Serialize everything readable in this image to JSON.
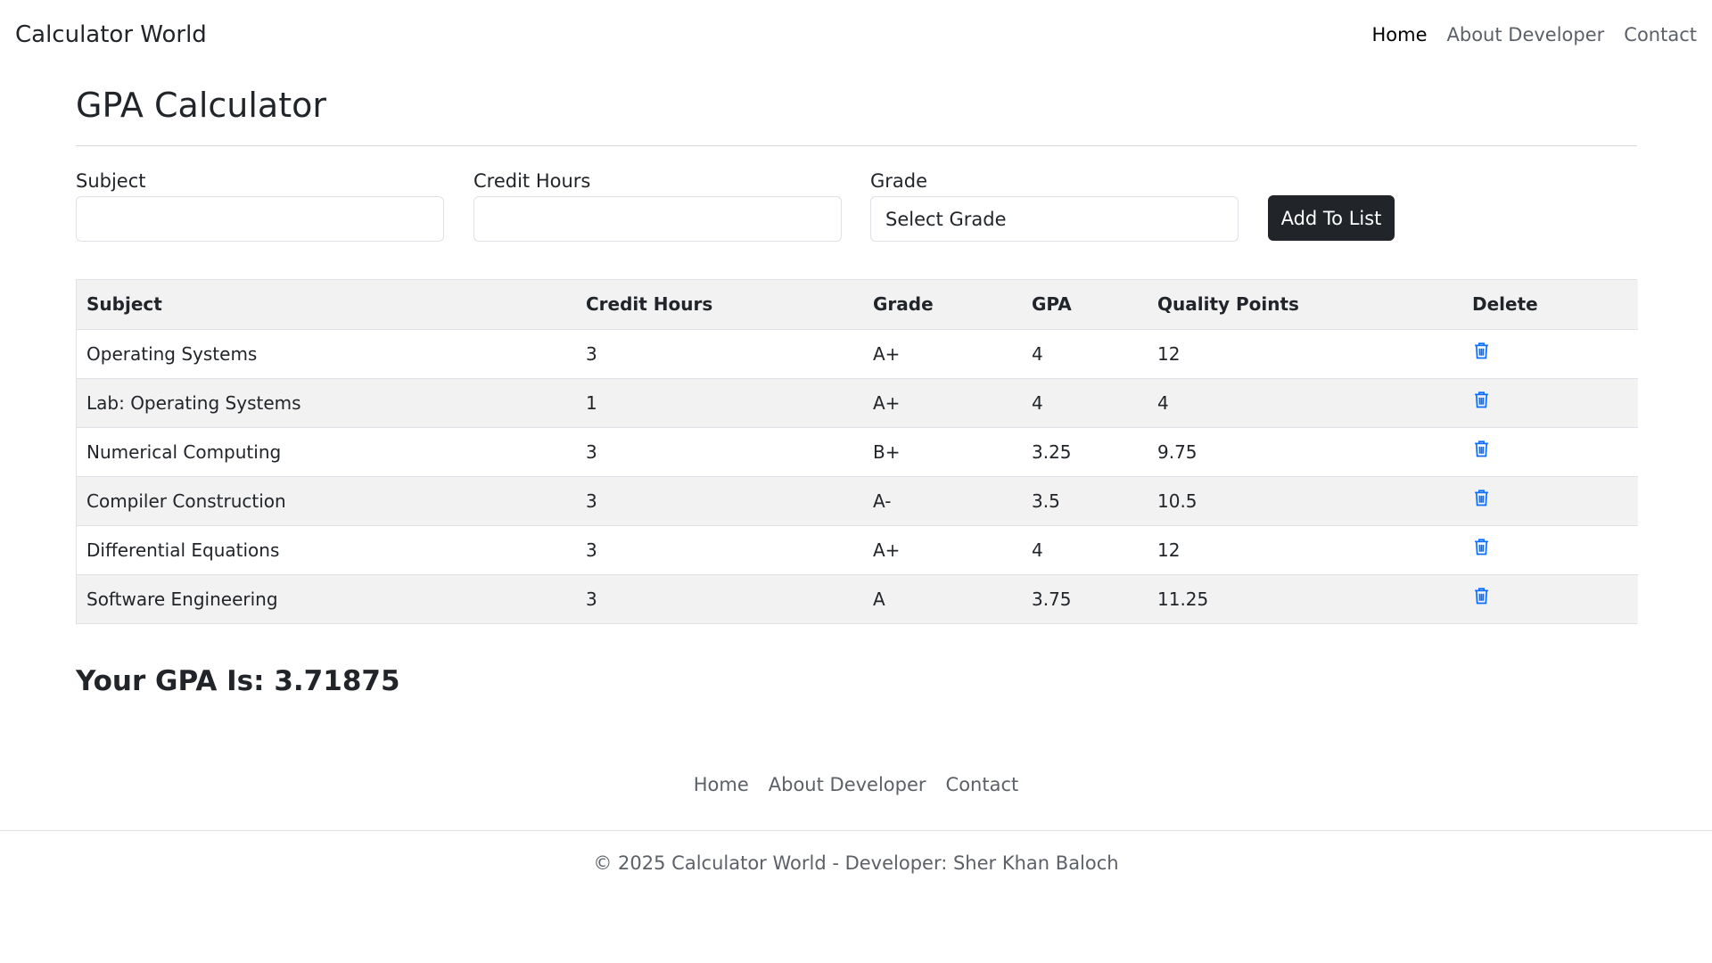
{
  "navbar": {
    "brand": "Calculator World",
    "links": [
      {
        "label": "Home",
        "active": true
      },
      {
        "label": "About Developer",
        "active": false
      },
      {
        "label": "Contact",
        "active": false
      }
    ]
  },
  "page": {
    "title": "GPA Calculator"
  },
  "form": {
    "subject_label": "Subject",
    "subject_value": "",
    "credit_label": "Credit Hours",
    "credit_value": "",
    "grade_label": "Grade",
    "grade_selected": "Select Grade",
    "add_button": "Add To List"
  },
  "table": {
    "headers": [
      "Subject",
      "Credit Hours",
      "Grade",
      "GPA",
      "Quality Points",
      "Delete"
    ],
    "rows": [
      {
        "subject": "Operating Systems",
        "credit": "3",
        "grade": "A+",
        "gpa": "4",
        "qp": "12"
      },
      {
        "subject": "Lab: Operating Systems",
        "credit": "1",
        "grade": "A+",
        "gpa": "4",
        "qp": "4"
      },
      {
        "subject": "Numerical Computing",
        "credit": "3",
        "grade": "B+",
        "gpa": "3.25",
        "qp": "9.75"
      },
      {
        "subject": "Compiler Construction",
        "credit": "3",
        "grade": "A-",
        "gpa": "3.5",
        "qp": "10.5"
      },
      {
        "subject": "Differential Equations",
        "credit": "3",
        "grade": "A+",
        "gpa": "4",
        "qp": "12"
      },
      {
        "subject": "Software Engineering",
        "credit": "3",
        "grade": "A",
        "gpa": "3.75",
        "qp": "11.25"
      }
    ],
    "delete_icon": "trash-icon",
    "delete_icon_color": "#0d6efd"
  },
  "result": {
    "text": "Your GPA Is: 3.71875"
  },
  "footer": {
    "links": [
      "Home",
      "About Developer",
      "Contact"
    ],
    "copyright": "© 2025 Calculator World - Developer: Sher Khan Baloch"
  }
}
